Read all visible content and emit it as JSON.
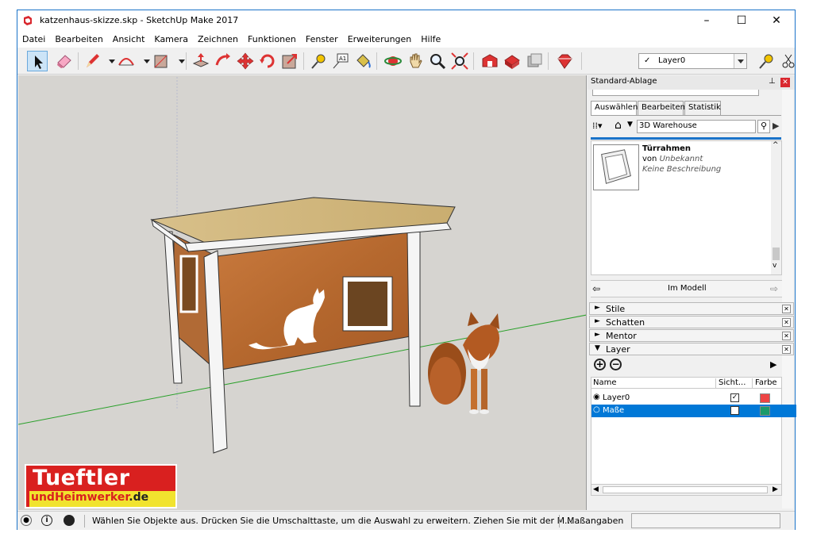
{
  "window": {
    "title": "katzenhaus-skizze.skp - SketchUp Make 2017",
    "controls": [
      "–",
      "☐",
      "✕"
    ]
  },
  "menu": [
    "Datei",
    "Bearbeiten",
    "Ansicht",
    "Kamera",
    "Zeichnen",
    "Funktionen",
    "Fenster",
    "Erweiterungen",
    "Hilfe"
  ],
  "toolbar": {
    "layer_checkmark": "✓",
    "layer_value": "Layer0"
  },
  "panel": {
    "title": "Standard-Ablage",
    "pin": "⊥",
    "tabs": [
      "Auswählen",
      "Bearbeiten",
      "Statistik"
    ],
    "search_value": "3D Warehouse",
    "component": {
      "name": "Türrahmen",
      "by_prefix": "von",
      "author": "Unbekannt",
      "description": "Keine Beschreibung"
    },
    "model_label": "Im Modell",
    "sections": [
      {
        "arrow": "►",
        "label": "Stile"
      },
      {
        "arrow": "►",
        "label": "Schatten"
      },
      {
        "arrow": "►",
        "label": "Mentor"
      },
      {
        "arrow": "▼",
        "label": "Layer"
      }
    ],
    "layer_table": {
      "col_name": "Name",
      "col_visible": "Sicht...",
      "col_color": "Farbe",
      "rows": [
        {
          "name": "Layer0",
          "active": "◉",
          "visible": "✓",
          "color": "#ee4444"
        },
        {
          "name": "Maße",
          "active": "○",
          "visible": "",
          "color": "#1a9a6a"
        }
      ]
    }
  },
  "status": {
    "message": "Wählen Sie Objekte aus. Drücken Sie die Umschalttaste, um die Auswahl zu erweitern. Ziehen Sie mit der M...",
    "measure_label": "Maßangaben"
  },
  "watermark": {
    "line1": "Tueftler",
    "line2a": "und",
    "line2b": "Heimwerker",
    "line2c": ".de"
  },
  "colors": {
    "accent": "#1a73c9",
    "selected_row": "#0078d7",
    "canvas": "#d6d4d0"
  }
}
